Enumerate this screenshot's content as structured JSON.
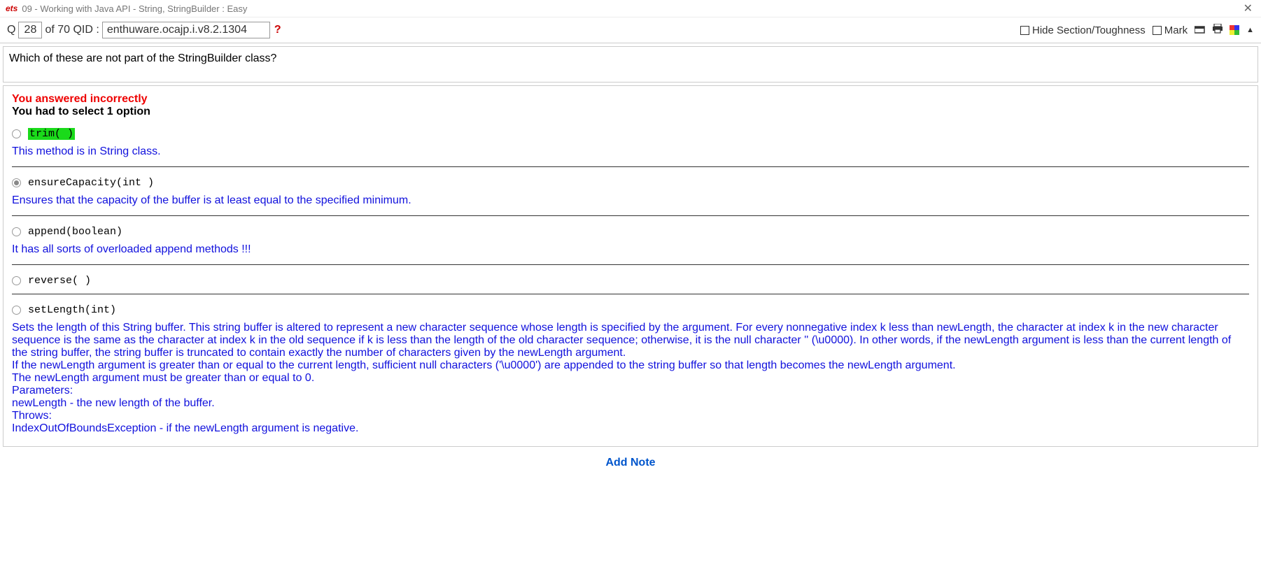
{
  "titlebar": {
    "brand": "ets",
    "title": "09 - Working with Java API - String, StringBuilder  :  Easy"
  },
  "nav": {
    "q_prefix": "Q",
    "q_number": "28",
    "of_label": "of 70 QID :",
    "qid": "enthuware.ocajp.i.v8.2.1304",
    "hide_label": "Hide Section/Toughness",
    "mark_label": "Mark"
  },
  "question": {
    "text": "Which of these are not part of the StringBuilder class?"
  },
  "feedback": {
    "wrong": "You answered incorrectly",
    "instruction": "You had to select 1 option"
  },
  "options": [
    {
      "code": "trim( )",
      "selected": false,
      "correct": true,
      "explain": "This method is in String class."
    },
    {
      "code": "ensureCapacity(int )",
      "selected": true,
      "correct": false,
      "explain": "Ensures that the capacity of the buffer is at least equal to the specified minimum."
    },
    {
      "code": "append(boolean)",
      "selected": false,
      "correct": false,
      "explain": "It has all sorts of overloaded append methods !!!"
    },
    {
      "code": "reverse( )",
      "selected": false,
      "correct": false,
      "explain": ""
    },
    {
      "code": "setLength(int)",
      "selected": false,
      "correct": false,
      "explain": "Sets the length of this String buffer. This string buffer is altered to represent a new character sequence whose length is specified by the argument. For every nonnegative index k less than newLength, the character at index k in the new character sequence is the same as the character at index k in the old sequence if k is less than the length of the old character sequence; otherwise, it is the null character '' (\\u0000). In other words, if the newLength argument is less than the current length of the string buffer, the string buffer is truncated to contain exactly the number of characters given by the newLength argument.\nIf the newLength argument is greater than or equal to the current length, sufficient null characters ('\\u0000') are appended to the string buffer so that length becomes the newLength argument.\nThe newLength argument must be greater than or equal to 0.\nParameters:\nnewLength - the new length of the buffer.\nThrows:\nIndexOutOfBoundsException - if the newLength argument is negative."
    }
  ],
  "footer": {
    "add_note": "Add Note"
  }
}
